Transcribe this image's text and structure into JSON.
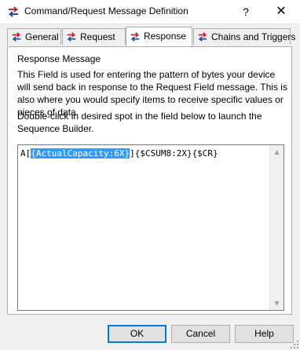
{
  "window": {
    "title": "Command/Request Message Definition",
    "help_label": "?",
    "close_label": "✕"
  },
  "tabs": [
    {
      "label": "General",
      "active": false
    },
    {
      "label": "Request",
      "active": false
    },
    {
      "label": "Response",
      "active": true
    },
    {
      "label": "Chains and Triggers",
      "active": false
    }
  ],
  "panel": {
    "section_title": "Response Message",
    "description": "This Field is used for entering the pattern of bytes your device will send back in response to the Request Field message.  This is also where you would specify items to receive specific values or pieces of data.",
    "instruction": "Double-click in desired spot in the field below to launch the Sequence Builder.",
    "editor": {
      "prefix": "A[",
      "selected": "{ActualCapacity:6X}",
      "suffix": "]{$CSUM8:2X}{$CR}"
    }
  },
  "buttons": {
    "ok": "OK",
    "cancel": "Cancel",
    "help": "Help"
  },
  "colors": {
    "selection": "#3399ff",
    "icon_red": "#c0282d",
    "icon_blue": "#1f4fa0"
  }
}
